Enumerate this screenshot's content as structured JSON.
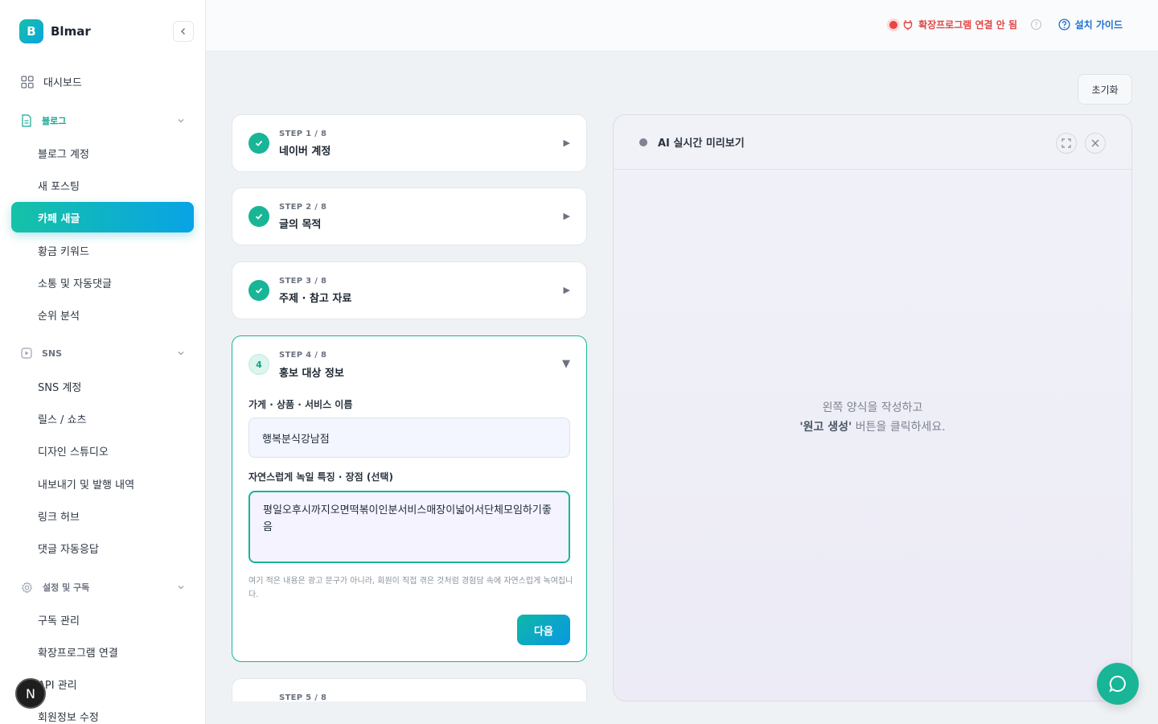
{
  "brand": {
    "logo_letter": "B",
    "name": "Blmar"
  },
  "sidebar": {
    "dashboard": "대시보드",
    "sections": [
      {
        "label": "블로그",
        "items": [
          "블로그 계정",
          "새 포스팅",
          "카페 새글",
          "황금 키워드",
          "소통 및 자동댓글",
          "순위 분석"
        ]
      },
      {
        "label": "SNS",
        "items": [
          "SNS 계정",
          "릴스 / 쇼츠",
          "디자인 스튜디오",
          "내보내기 및 발행 내역",
          "링크 허브",
          "댓글 자동응답"
        ]
      },
      {
        "label": "설정 및 구독",
        "items": [
          "구독 관리",
          "확장프로그램 연결",
          "API 관리",
          "회원정보 수정"
        ]
      }
    ],
    "active_item": "카페 새글",
    "avatar_letter": "N"
  },
  "topbar": {
    "connection_status": "확장프로그램 연결 안 됨",
    "guide_label": "설치 가이드",
    "help_glyph": "?"
  },
  "reset_label": "초기화",
  "steps": [
    {
      "label": "STEP 1 / 8",
      "title": "네이버 계정"
    },
    {
      "label": "STEP 2 / 8",
      "title": "글의 목적"
    },
    {
      "label": "STEP 3 / 8",
      "title": "주제 · 참고 자료"
    }
  ],
  "current_step": {
    "number": "4",
    "label": "STEP 4 / 8",
    "title": "홍보 대상 정보",
    "name_label": "가게 · 상품 · 서비스 이름",
    "name_value": "행복분식강남점",
    "features_label": "자연스럽게 녹일 특징 · 장점 (선택)",
    "features_value": "평일오후시까지오면떡볶이인분서비스매장이넓어서단체모임하기좋음",
    "hint": "여기 적은 내용은 광고 문구가 아니라, 회원이 직접 겪은 것처럼 경험담 속에 자연스럽게 녹여집니다.",
    "next_label": "다음"
  },
  "next_step": {
    "label": "STEP 5 / 8"
  },
  "preview": {
    "title": "AI 실시간 미리보기",
    "message_line1": "왼쪽 양식을 작성하고",
    "message_highlight": "'원고 생성'",
    "message_line2": " 버튼을 클릭하세요."
  }
}
